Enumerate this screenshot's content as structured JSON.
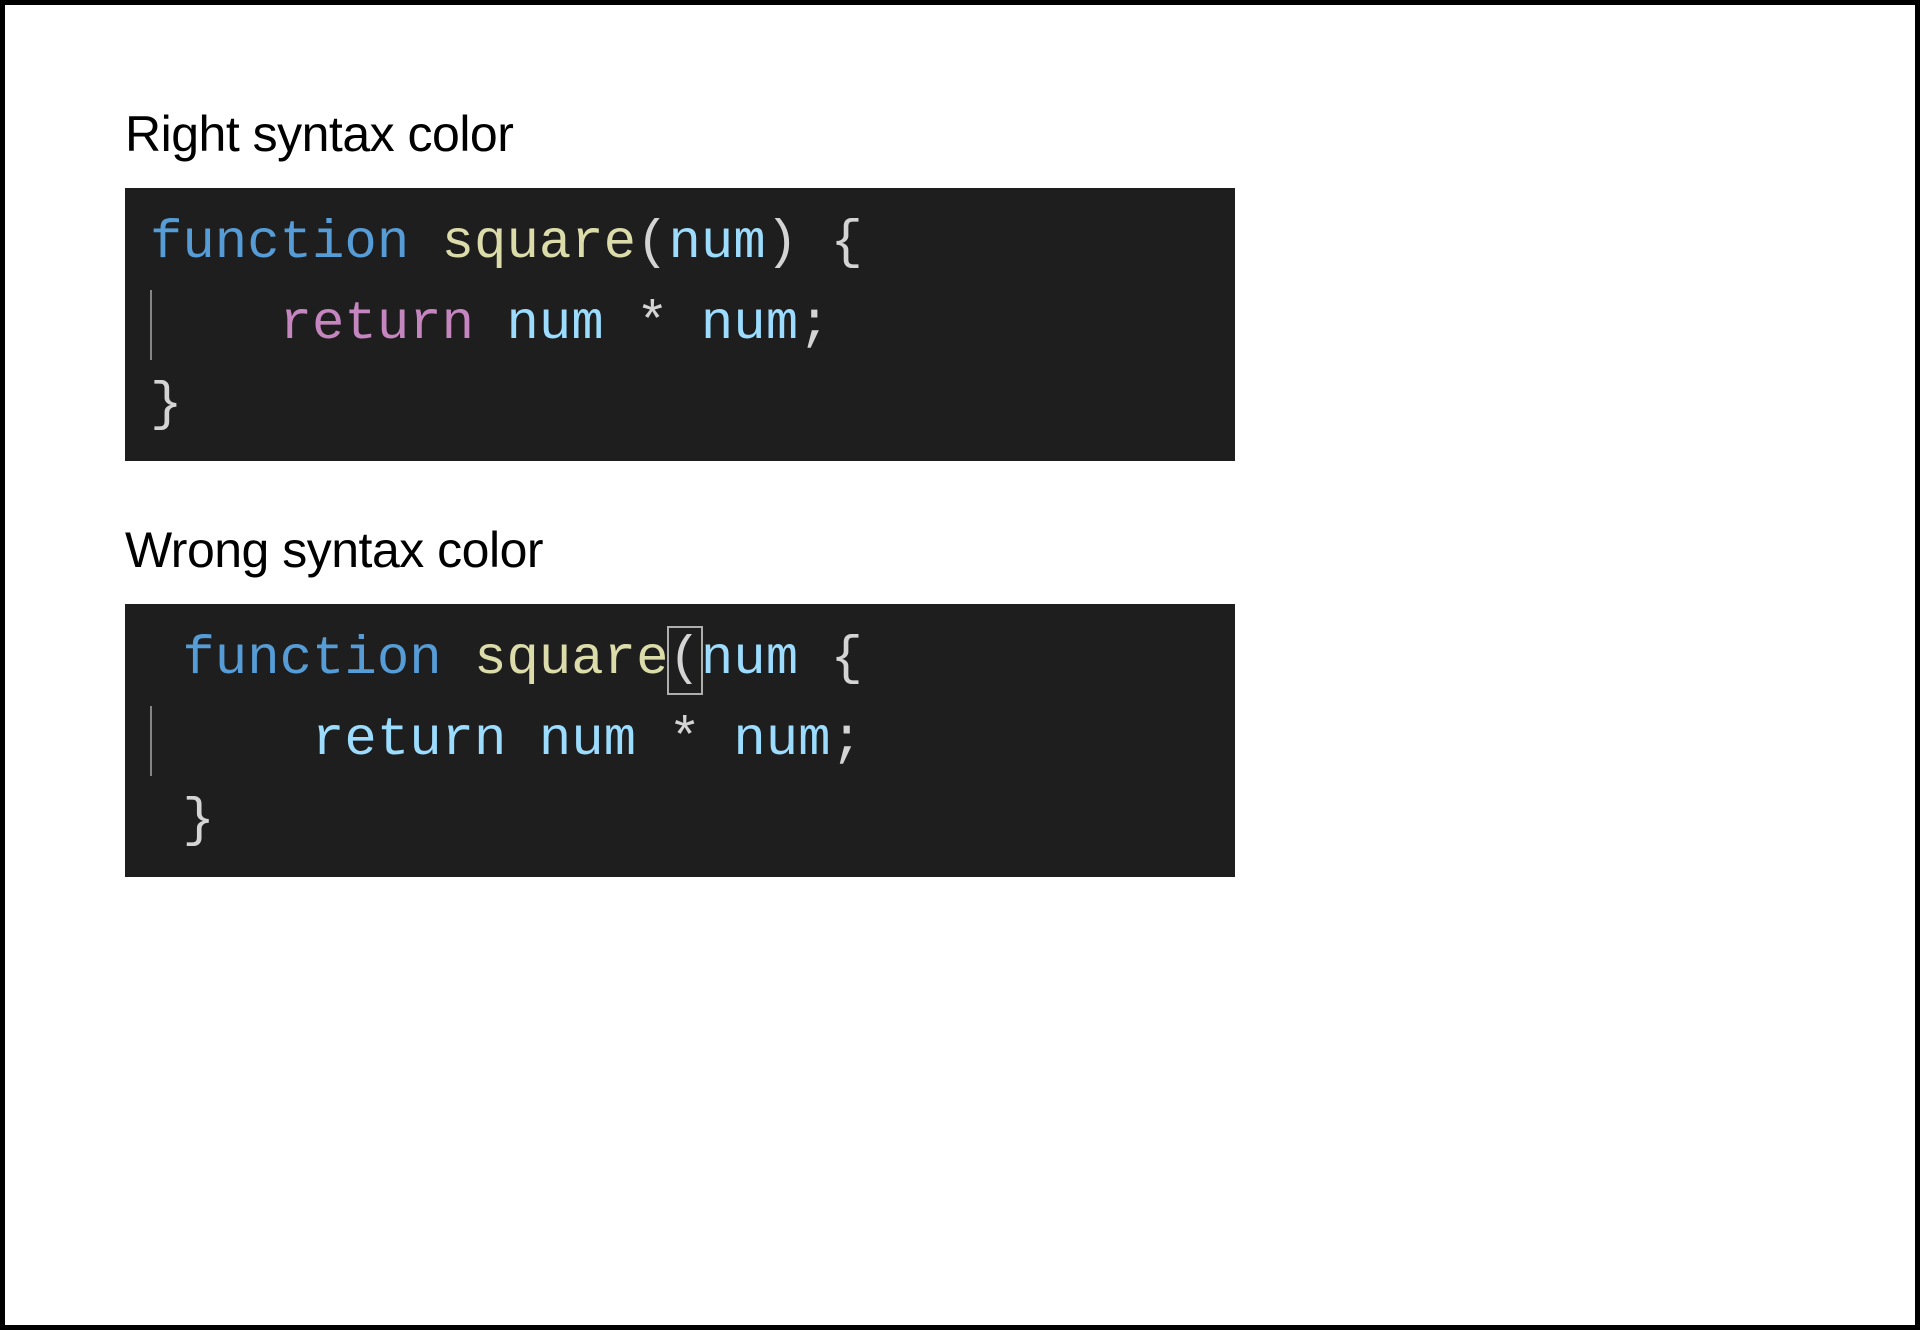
{
  "sections": {
    "right": {
      "title": "Right syntax color",
      "code": {
        "line1": {
          "keyword": "function",
          "space1": " ",
          "funcname": "square",
          "lparen": "(",
          "param": "num",
          "rparen": ")",
          "space2": " ",
          "lbrace": "{"
        },
        "line2": {
          "indent": "    ",
          "keyword": "return",
          "space1": " ",
          "var1": "num",
          "space2": " ",
          "op": "*",
          "space3": " ",
          "var2": "num",
          "semi": ";"
        },
        "line3": {
          "rbrace": "}"
        }
      }
    },
    "wrong": {
      "title": "Wrong syntax color",
      "code": {
        "line1": {
          "keyword": "function",
          "space1": " ",
          "funcname": "square",
          "lparen": "(",
          "param": "num",
          "space2": " ",
          "lbrace": "{"
        },
        "line2": {
          "indent": "    ",
          "keyword": "return",
          "space1": " ",
          "var1": "num",
          "space2": " ",
          "op": "*",
          "space3": " ",
          "var2": "num",
          "semi": ";"
        },
        "line3": {
          "rbrace": "}"
        }
      }
    }
  },
  "colors": {
    "keyword_blue": "#569cd6",
    "funcname": "#dcdcaa",
    "punctuation": "#d4d4d4",
    "parameter": "#9cdcfe",
    "keyword_pink": "#c586c0",
    "variable": "#9cdcfe",
    "operator": "#d4d4d4",
    "background": "#1e1e1e"
  }
}
